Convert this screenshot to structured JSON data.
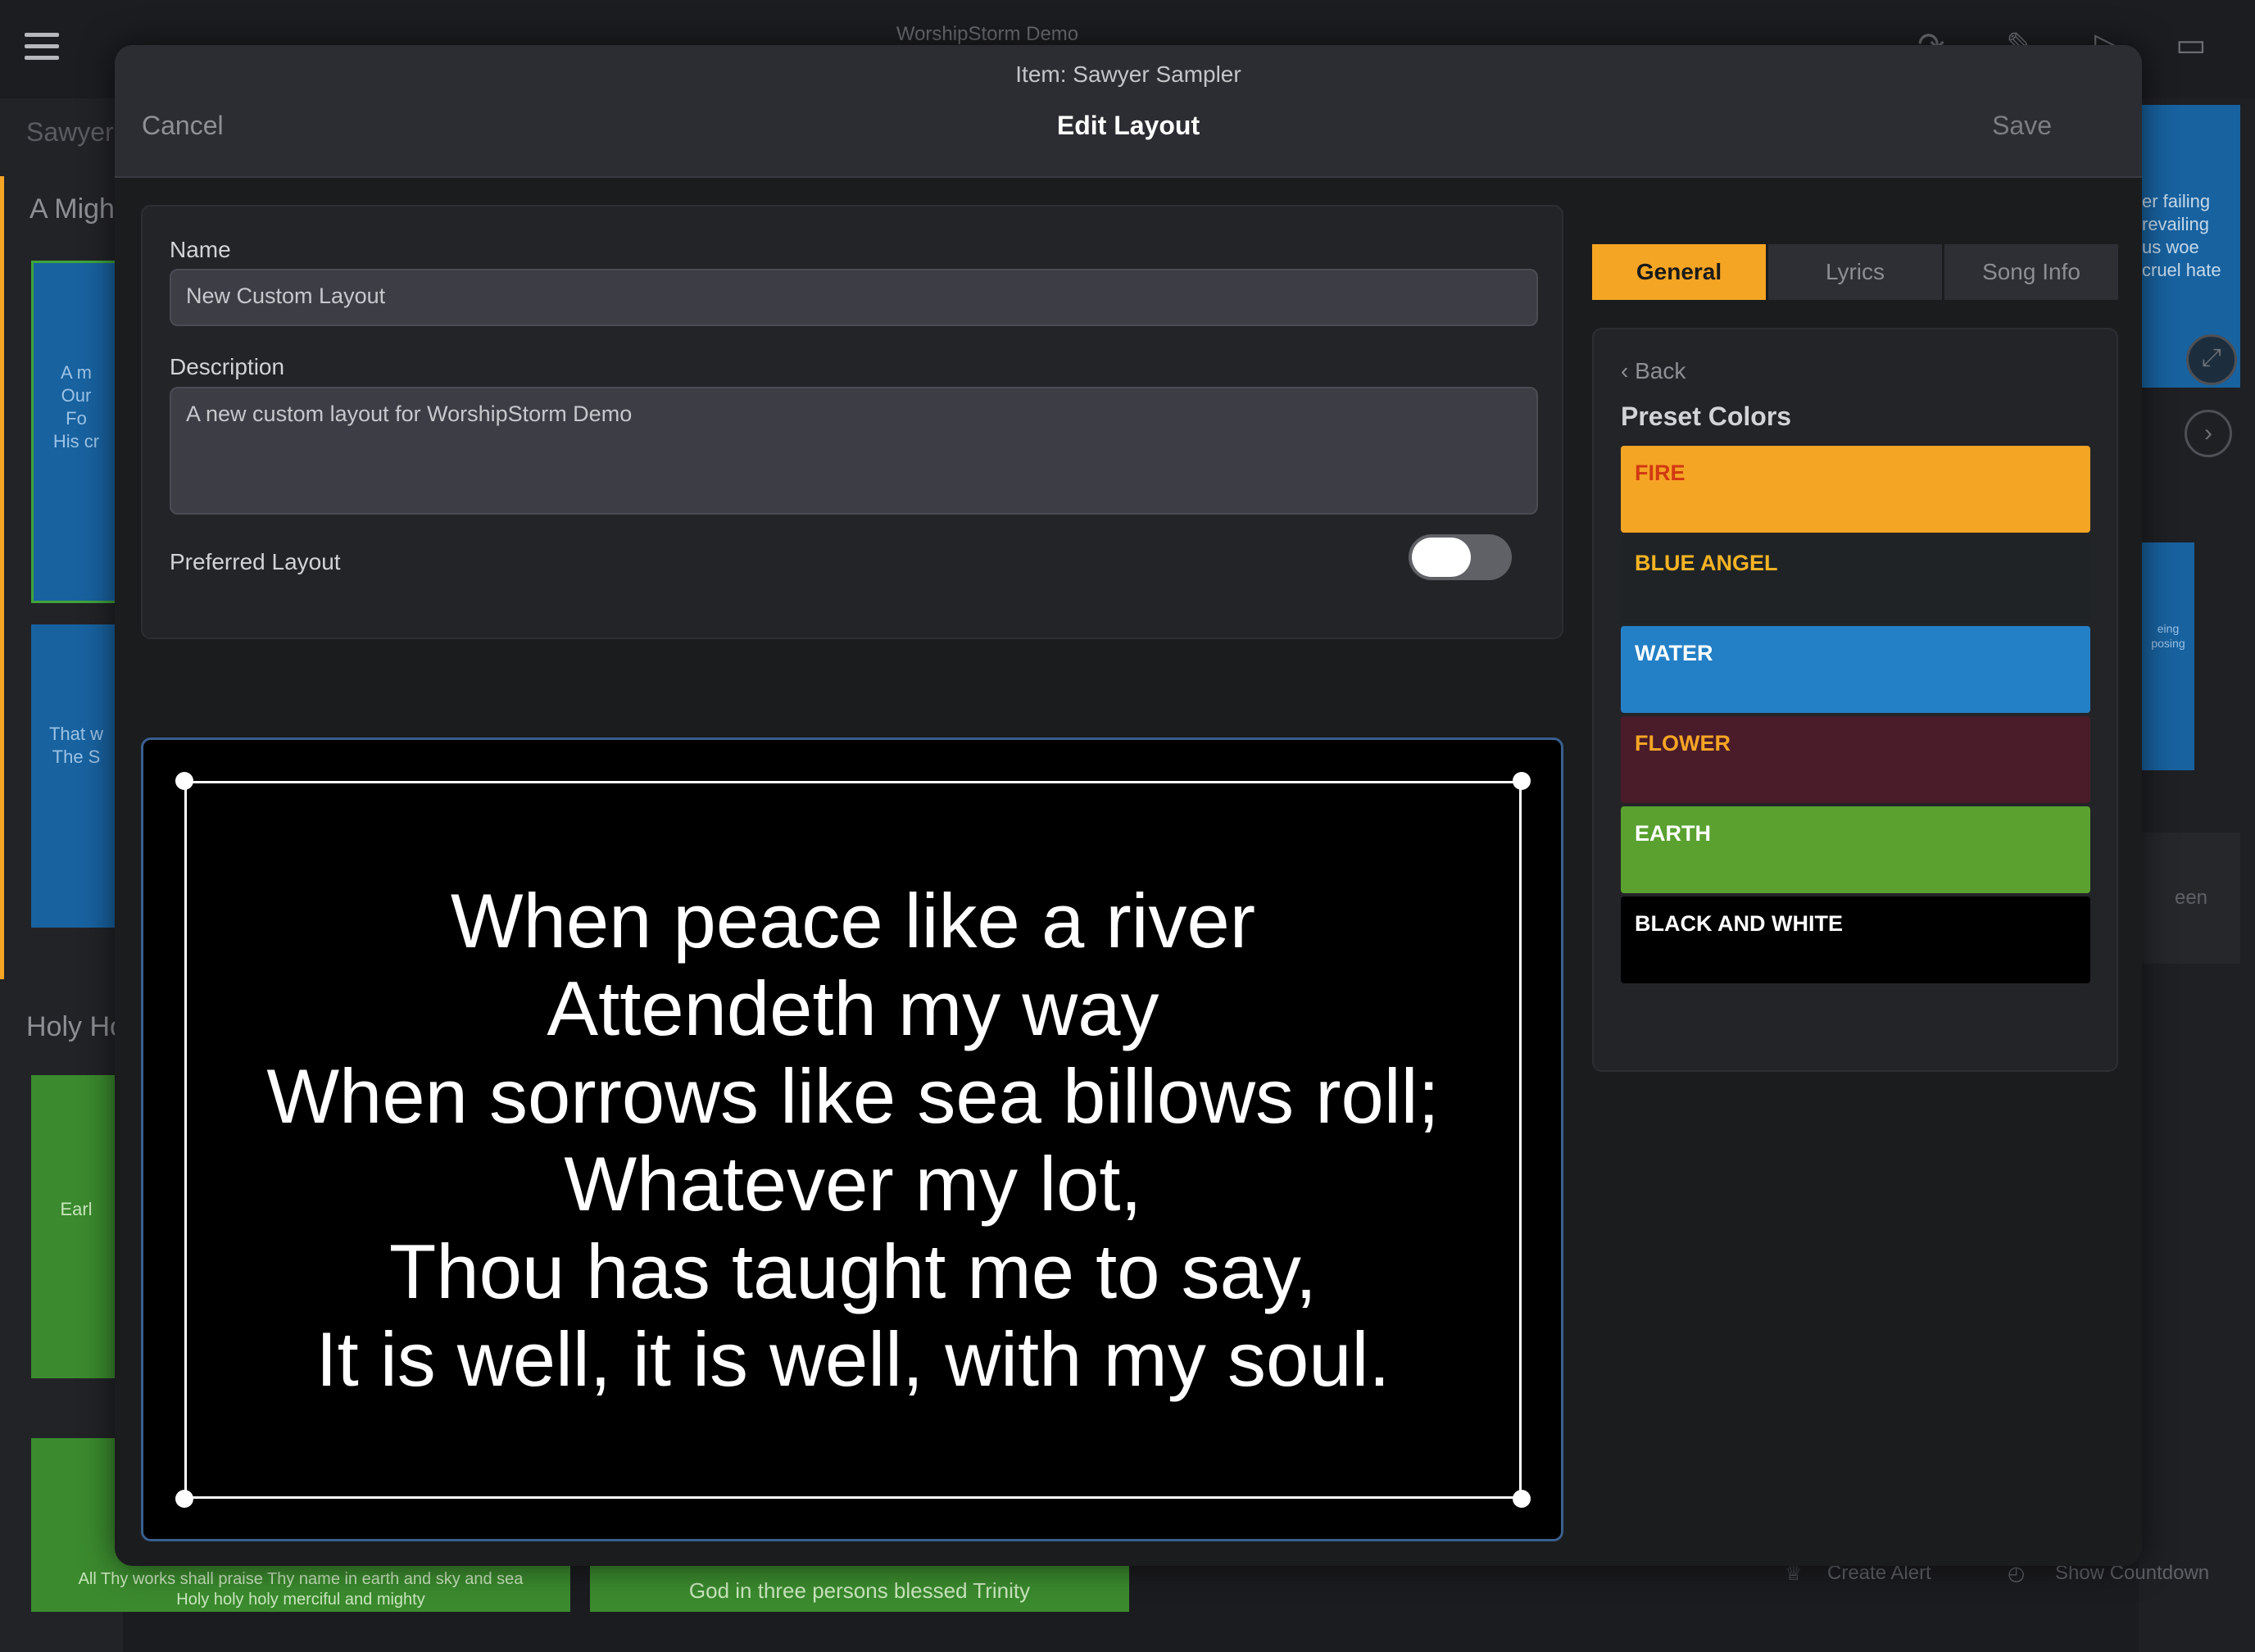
{
  "app": {
    "title": "WorshipStorm Demo",
    "sidebar_header": "Sawyer",
    "group1": "A Migh",
    "group2": "Holy Ho",
    "card1_text": "A m\nOur\nFo\nHis cr",
    "card2_text": "That w\nThe S",
    "card3_text": "Earl",
    "card4_text": "All Thy works shall praise Thy name in earth and sky and sea\nHoly holy holy merciful and mighty",
    "card5_text": "God in three persons blessed Trinity",
    "right_card_text": "er failing\nrevailing\nus woe\ncruel hate",
    "right_small_text": "eing\nposing",
    "right_green_text": "een",
    "create_alert": "Create Alert",
    "show_countdown": "Show Countdown"
  },
  "modal": {
    "item_label": "Item: Sawyer Sampler",
    "title": "Edit Layout",
    "cancel": "Cancel",
    "save": "Save"
  },
  "form": {
    "name_label": "Name",
    "name_value": "New Custom Layout",
    "description_label": "Description",
    "description_value": "A new custom layout for WorshipStorm Demo",
    "preferred_label": "Preferred Layout",
    "preferred_on": false
  },
  "preview": {
    "lines": [
      "When peace like a river",
      "Attendeth my way",
      "When sorrows like sea billows roll;",
      "Whatever my lot,",
      "Thou has taught me to say,",
      "It is well, it is well, with my soul."
    ]
  },
  "tabs": {
    "general": "General",
    "lyrics": "Lyrics",
    "song_info": "Song Info",
    "active": "general"
  },
  "presets": {
    "back": "Back",
    "title": "Preset Colors",
    "items": [
      {
        "name": "FIRE",
        "bg": "#f5a524",
        "fg": "#d13a12"
      },
      {
        "name": "BLUE ANGEL",
        "bg": "#1f2326",
        "fg": "#f5b324"
      },
      {
        "name": "WATER",
        "bg": "#2480c6",
        "fg": "#ffffff"
      },
      {
        "name": "FLOWER",
        "bg": "#4a1c2a",
        "fg": "#f5a524"
      },
      {
        "name": "EARTH",
        "bg": "#5aa130",
        "fg": "#ffffff"
      },
      {
        "name": "BLACK AND WHITE",
        "bg": "#000000",
        "fg": "#ffffff"
      }
    ]
  }
}
